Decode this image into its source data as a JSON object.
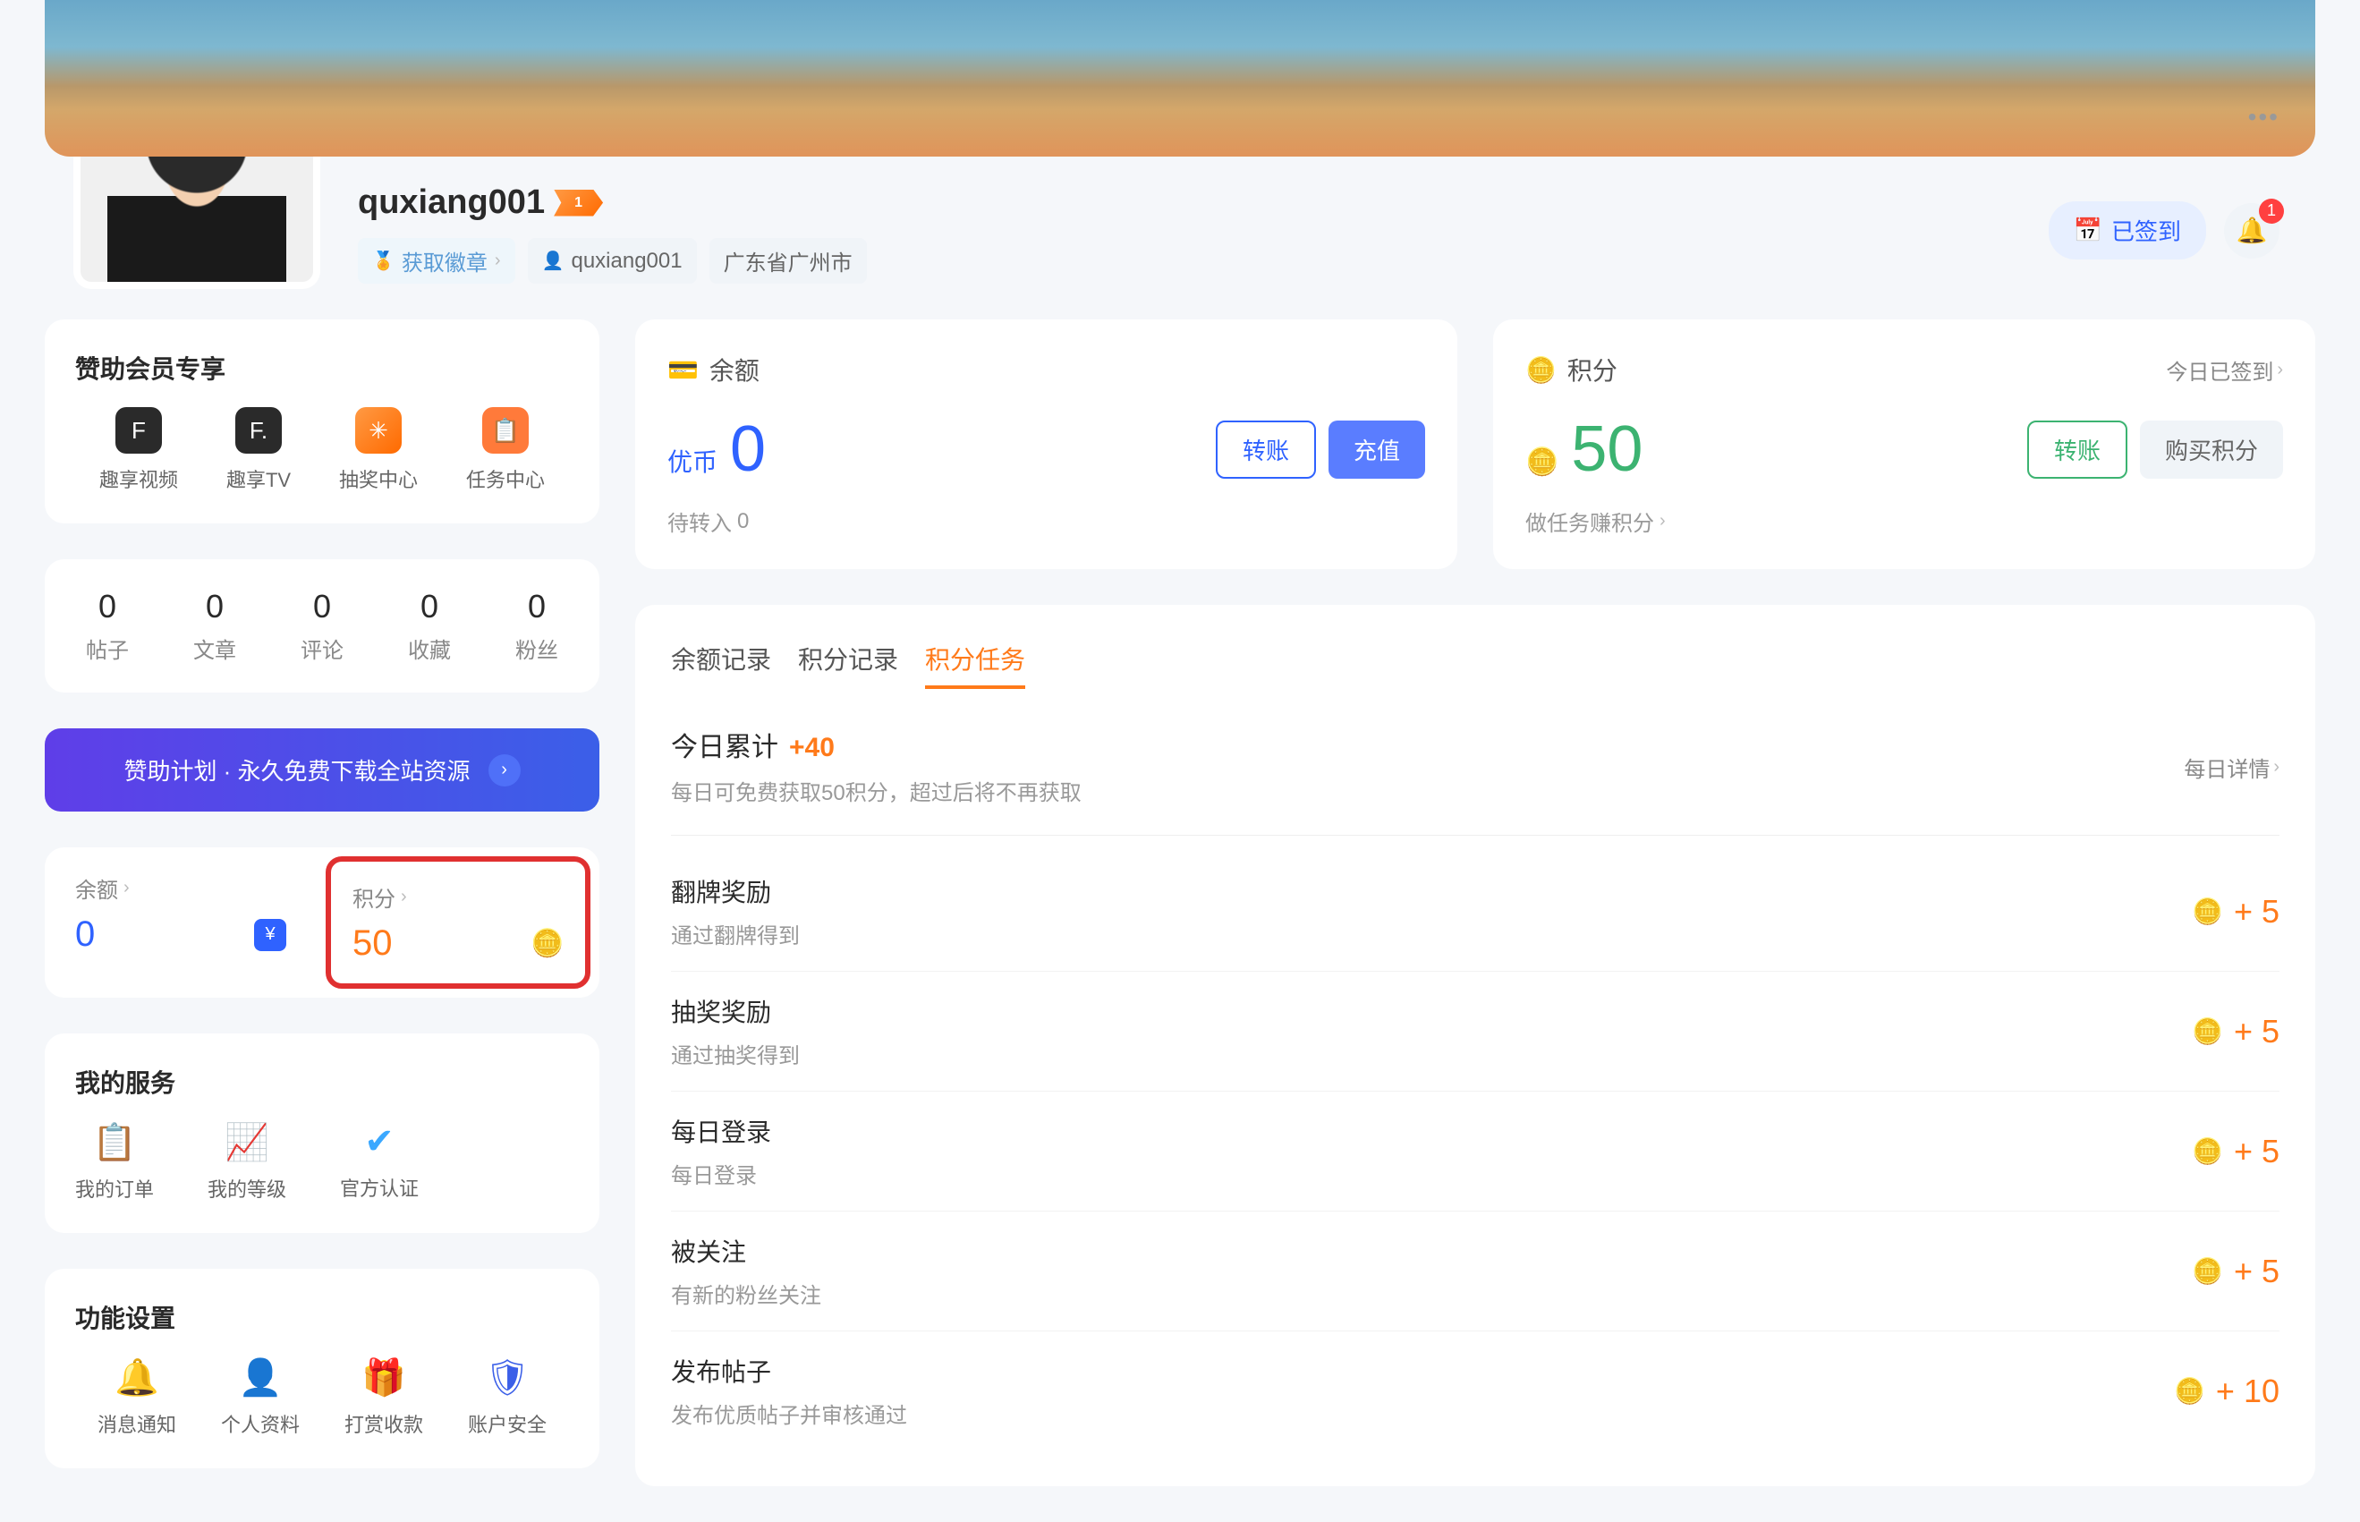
{
  "profile": {
    "username": "quxiang001",
    "level": "1",
    "badge_tag": "获取徽章",
    "handle": "quxiang001",
    "location": "广东省广州市",
    "checkin_button": "已签到",
    "notification_count": "1"
  },
  "sidebar": {
    "sponsor_title": "赞助会员专享",
    "sponsor_items": [
      {
        "label": "趣享视频",
        "icon": "F"
      },
      {
        "label": "趣享TV",
        "icon": "F."
      },
      {
        "label": "抽奖中心",
        "icon": "✳"
      },
      {
        "label": "任务中心",
        "icon": "📋"
      }
    ],
    "stats": [
      {
        "value": "0",
        "label": "帖子"
      },
      {
        "value": "0",
        "label": "文章"
      },
      {
        "value": "0",
        "label": "评论"
      },
      {
        "value": "0",
        "label": "收藏"
      },
      {
        "value": "0",
        "label": "粉丝"
      }
    ],
    "sponsor_banner": "赞助计划 · 永久免费下载全站资源",
    "balance_points": {
      "balance_label": "余额",
      "balance_value": "0",
      "points_label": "积分",
      "points_value": "50"
    },
    "services_title": "我的服务",
    "services": [
      {
        "label": "我的订单",
        "icon": "clipboard",
        "class": "svc-blue"
      },
      {
        "label": "我的等级",
        "icon": "chart",
        "class": "svc-blue"
      },
      {
        "label": "官方认证",
        "icon": "verified",
        "class": "svc-lblue"
      }
    ],
    "settings_title": "功能设置",
    "settings": [
      {
        "label": "消息通知",
        "class": "svc-orange"
      },
      {
        "label": "个人资料",
        "class": "svc-lblue"
      },
      {
        "label": "打赏收款",
        "class": "svc-pink"
      },
      {
        "label": "账户安全",
        "class": "svc-blue"
      }
    ]
  },
  "balance_card": {
    "title": "余额",
    "currency": "优币",
    "value": "0",
    "transfer_btn": "转账",
    "topup_btn": "充值",
    "footer_label": "待转入",
    "footer_value": "0"
  },
  "points_card": {
    "title": "积分",
    "header_link": "今日已签到",
    "value": "50",
    "transfer_btn": "转账",
    "buy_btn": "购买积分",
    "footer": "做任务赚积分"
  },
  "tabs": [
    {
      "label": "余额记录",
      "active": false
    },
    {
      "label": "积分记录",
      "active": false
    },
    {
      "label": "积分任务",
      "active": true
    }
  ],
  "task_summary": {
    "title": "今日累计",
    "bonus": "+40",
    "desc": "每日可免费获取50积分，超过后将不再获取",
    "detail_link": "每日详情"
  },
  "tasks": [
    {
      "name": "翻牌奖励",
      "desc": "通过翻牌得到",
      "reward": "+ 5"
    },
    {
      "name": "抽奖奖励",
      "desc": "通过抽奖得到",
      "reward": "+ 5"
    },
    {
      "name": "每日登录",
      "desc": "每日登录",
      "reward": "+ 5"
    },
    {
      "name": "被关注",
      "desc": "有新的粉丝关注",
      "reward": "+ 5"
    },
    {
      "name": "发布帖子",
      "desc": "发布优质帖子并审核通过",
      "reward": "+ 10"
    }
  ]
}
